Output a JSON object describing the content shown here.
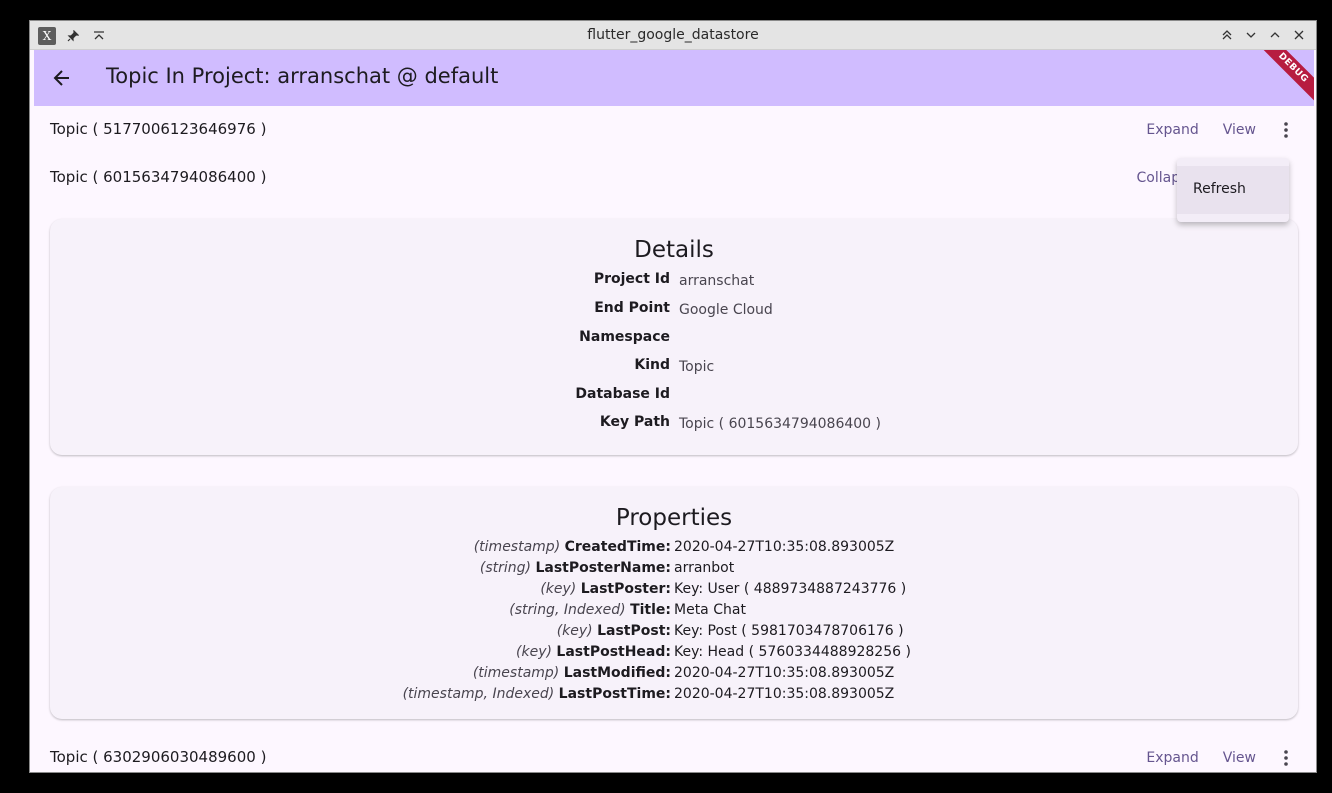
{
  "window": {
    "title": "flutter_google_datastore"
  },
  "appbar": {
    "title": "Topic In Project: arranschat @ default",
    "debug_label": "DEBUG"
  },
  "rows": [
    {
      "label": "Topic ( 5177006123646976 )",
      "expand_label": "Expand",
      "view_label": "View"
    },
    {
      "label": "Topic ( 6015634794086400 )",
      "collapse_label": "Collapse"
    },
    {
      "label": "Topic ( 6302906030489600 )",
      "expand_label": "Expand",
      "view_label": "View"
    }
  ],
  "details": {
    "title": "Details",
    "fields": [
      {
        "key": "Project Id",
        "value": "arranschat"
      },
      {
        "key": "End Point",
        "value": "Google Cloud"
      },
      {
        "key": "Namespace",
        "value": ""
      },
      {
        "key": "Kind",
        "value": "Topic"
      },
      {
        "key": "Database Id",
        "value": ""
      },
      {
        "key": "Key Path",
        "value": "Topic ( 6015634794086400 )"
      }
    ]
  },
  "properties": {
    "title": "Properties",
    "items": [
      {
        "type": "(timestamp)",
        "name": "CreatedTime:",
        "value": "2020-04-27T10:35:08.893005Z"
      },
      {
        "type": "(string)",
        "name": "LastPosterName:",
        "value": "arranbot"
      },
      {
        "type": "(key)",
        "name": "LastPoster:",
        "value": "Key: User ( 4889734887243776 )"
      },
      {
        "type": "(string, Indexed)",
        "name": "Title:",
        "value": "Meta Chat"
      },
      {
        "type": "(key)",
        "name": "LastPost:",
        "value": "Key: Post ( 5981703478706176 )"
      },
      {
        "type": "(key)",
        "name": "LastPostHead:",
        "value": "Key: Head ( 5760334488928256 )"
      },
      {
        "type": "(timestamp)",
        "name": "LastModified:",
        "value": "2020-04-27T10:35:08.893005Z"
      },
      {
        "type": "(timestamp, Indexed)",
        "name": "LastPostTime:",
        "value": "2020-04-27T10:35:08.893005Z"
      }
    ]
  },
  "popup_menu": {
    "items": [
      {
        "label": "Refresh"
      }
    ]
  },
  "colors": {
    "appbar_bg": "#d0bcff",
    "accent_text": "#65558f",
    "surface": "#fdf7ff",
    "card_bg": "#f7f2fa",
    "debug_ribbon": "#b71c40"
  }
}
